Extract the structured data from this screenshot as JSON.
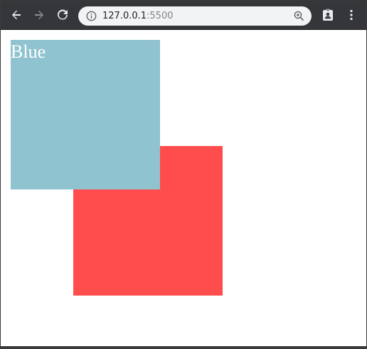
{
  "browser": {
    "address_bar": {
      "host": "127.0.0.1",
      "port": ":5500"
    },
    "icons": {
      "back": "arrow-left-icon",
      "forward": "arrow-right-icon",
      "reload": "reload-icon",
      "site_info": "info-icon",
      "zoom": "zoom-in-icon",
      "extension": "extension-icon",
      "menu": "kebab-menu-icon"
    },
    "colors": {
      "toolbar": "#35363a",
      "omnibox": "#f1f3f4"
    }
  },
  "page": {
    "blue_box": {
      "label": "Blue",
      "color": "#8fc3cf"
    },
    "red_box": {
      "color": "#ff4d4d"
    }
  }
}
